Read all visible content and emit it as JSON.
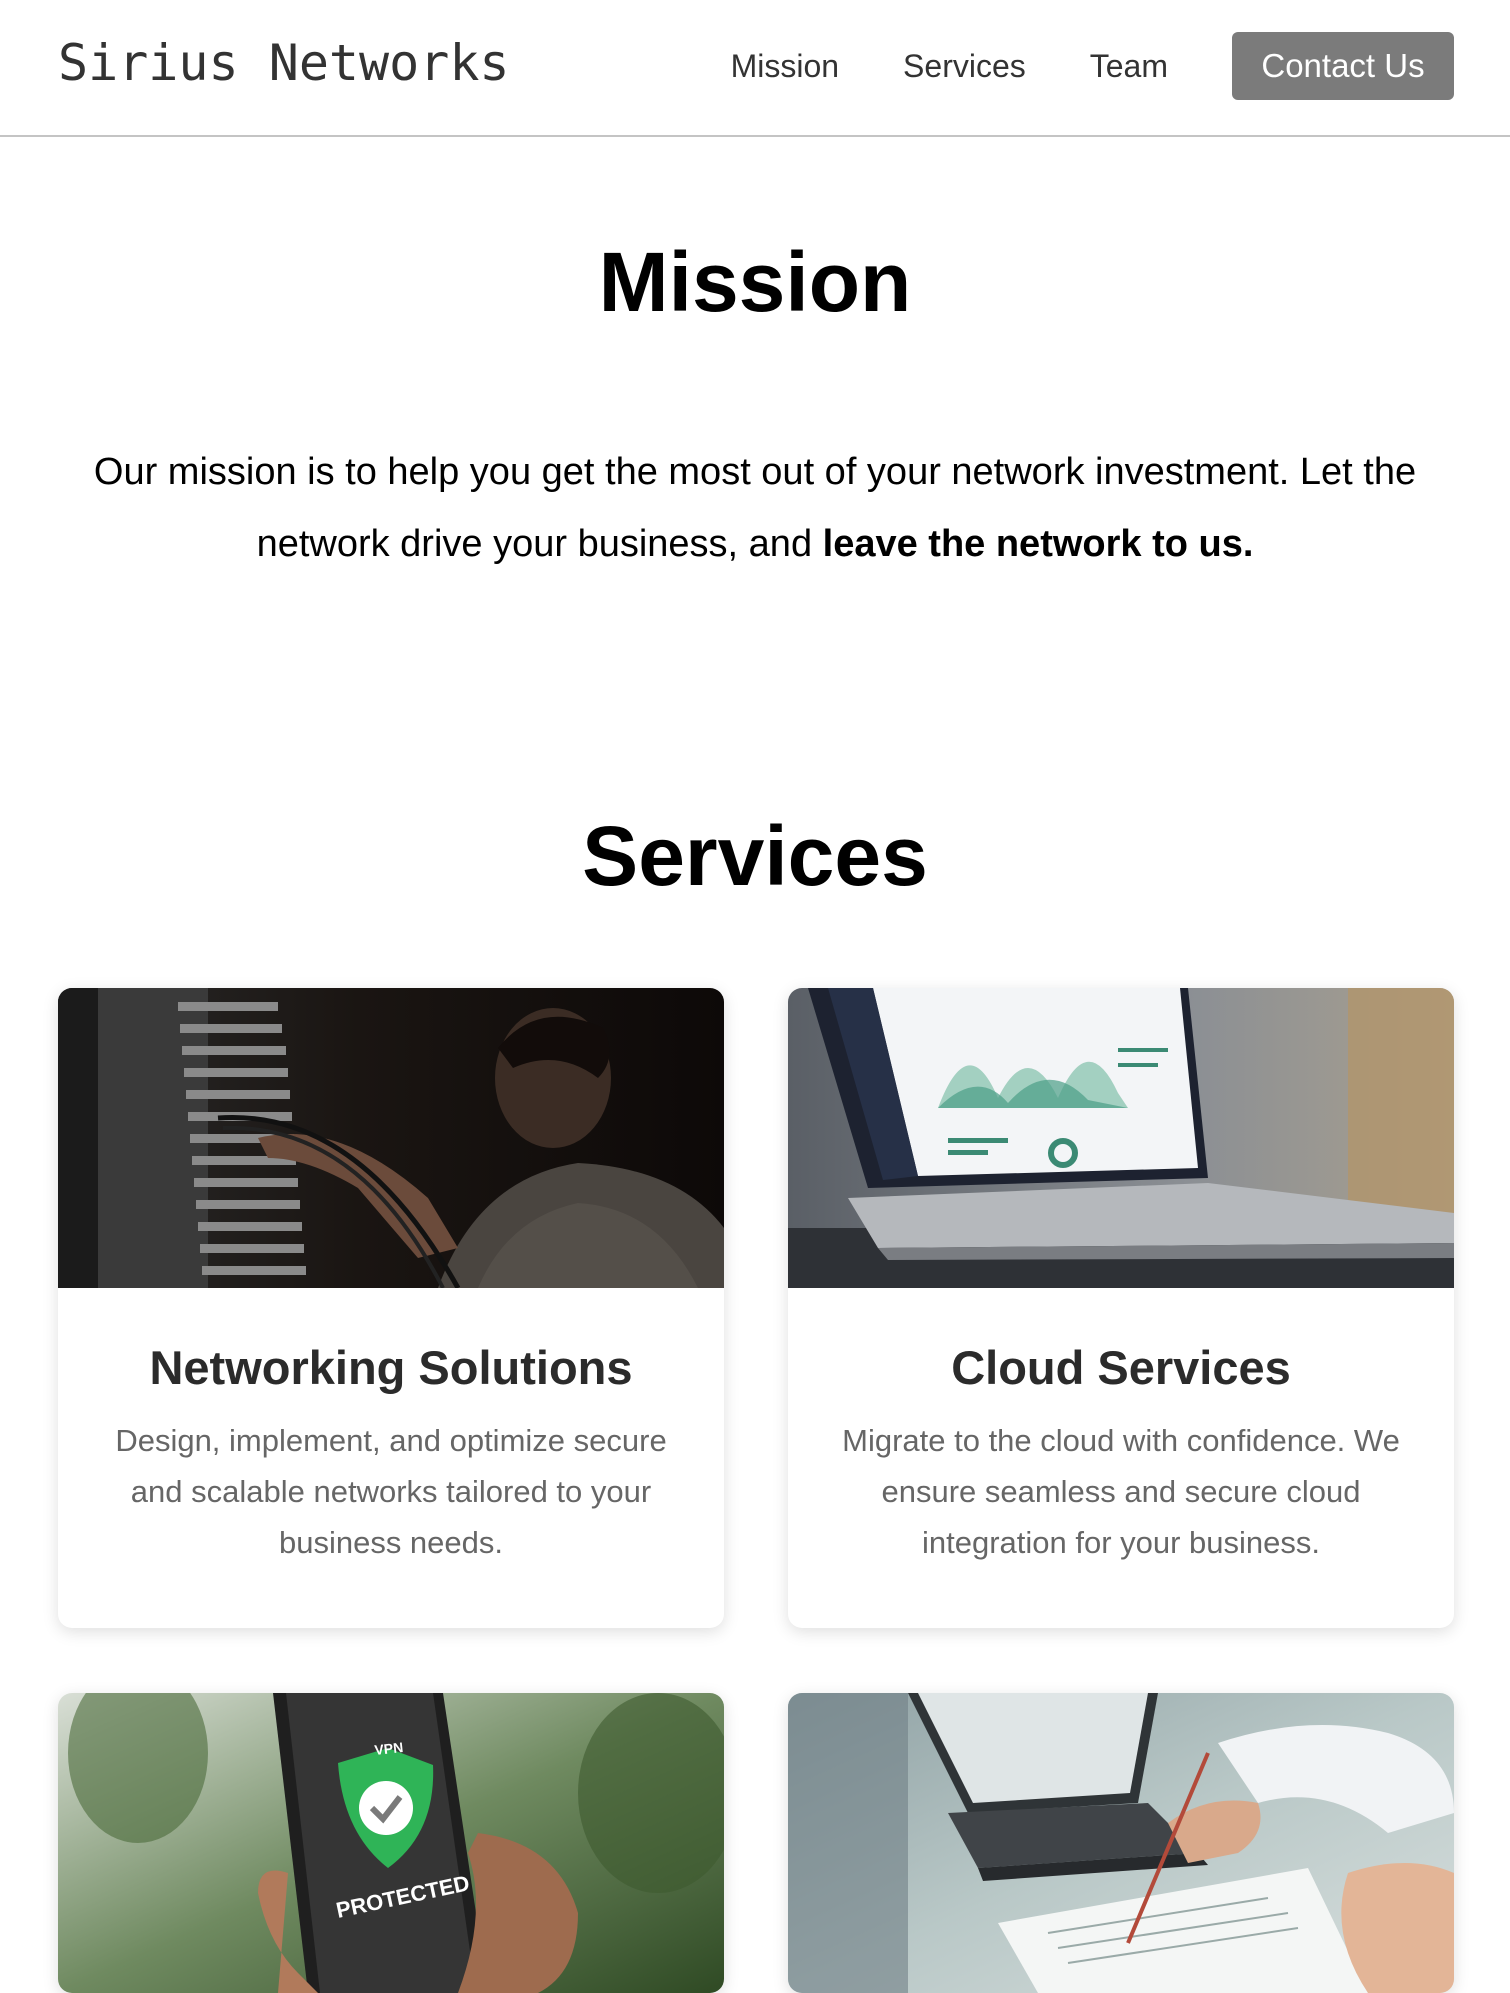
{
  "header": {
    "brand": "Sirius Networks",
    "nav": [
      {
        "label": "Mission"
      },
      {
        "label": "Services"
      },
      {
        "label": "Team"
      }
    ],
    "contact_label": "Contact Us",
    "contact_color": "#7b7b7b"
  },
  "mission": {
    "title": "Mission",
    "text_plain": "Our mission is to help you get the most out of your network investment. Let the network drive your business, and ",
    "text_bold": "leave the network to us."
  },
  "services": {
    "title": "Services",
    "cards": [
      {
        "title": "Networking Solutions",
        "description": "Design, implement, and optimize secure and scalable networks tailored to your business needs."
      },
      {
        "title": "Cloud Services",
        "description": "Migrate to the cloud with confidence. We ensure seamless and secure cloud integration for your business."
      },
      {
        "image_text_top": "VPN",
        "image_text_bottom": "PROTECTED"
      },
      {}
    ]
  }
}
